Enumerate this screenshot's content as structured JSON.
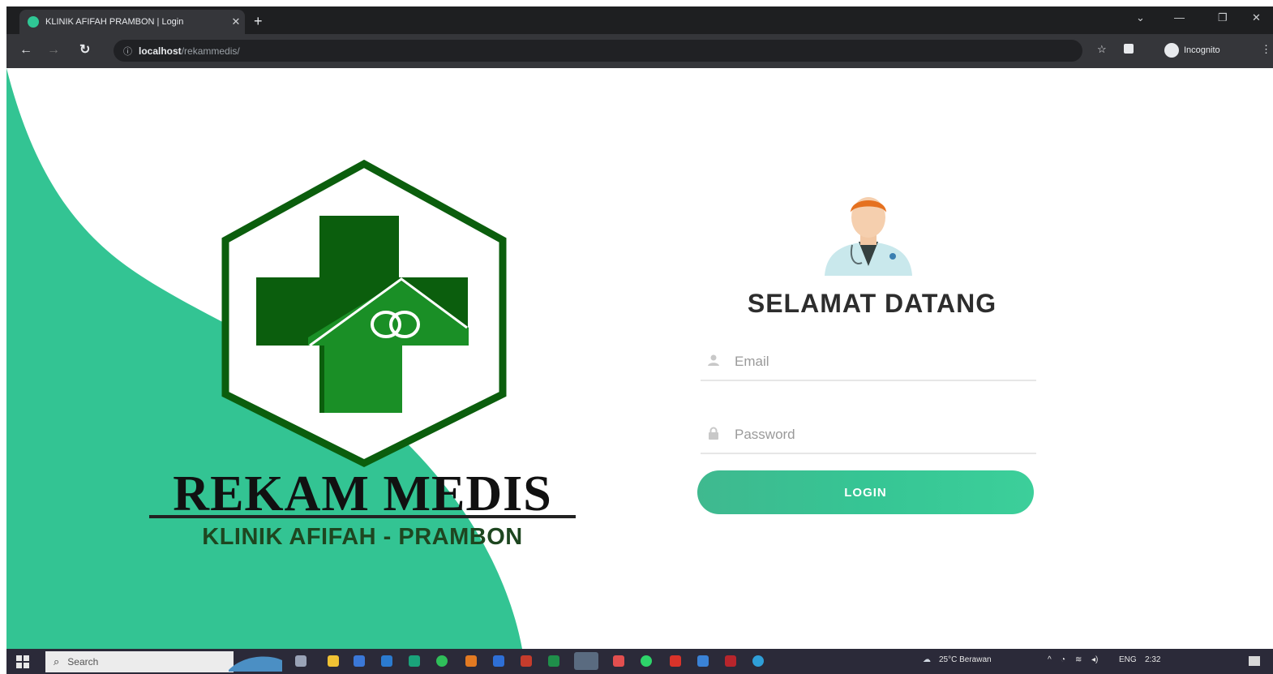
{
  "browser": {
    "tab_title": "KLINIK AFIFAH PRAMBON | Login",
    "tab_close": "✕",
    "new_tab": "+",
    "url_host": "localhost",
    "url_path": "/rekammedis/",
    "incognito_label": "Incognito",
    "window_controls": {
      "minimize": "—",
      "restore": "❐",
      "close": "✕",
      "tab_search": "⌄"
    },
    "nav": {
      "back": "←",
      "forward": "→",
      "reload": "↻",
      "site_info": "ⓘ",
      "bookmark": "☆",
      "menu": "⋮"
    }
  },
  "brand": {
    "title": "REKAM MEDIS",
    "subtitle": "KLINIK AFIFAH - PRAMBON"
  },
  "login": {
    "welcome": "SELAMAT DATANG",
    "email_placeholder": "Email",
    "password_placeholder": "Password",
    "button_label": "LOGIN"
  },
  "taskbar": {
    "search_placeholder": "Search",
    "weather": "25°C Berawan",
    "language": "ENG",
    "time": "2:32"
  },
  "colors": {
    "accent": "#36c594",
    "logo_dark": "#0b5e0d",
    "logo_mid": "#138a1c",
    "logo_light": "#1f9a2b"
  }
}
